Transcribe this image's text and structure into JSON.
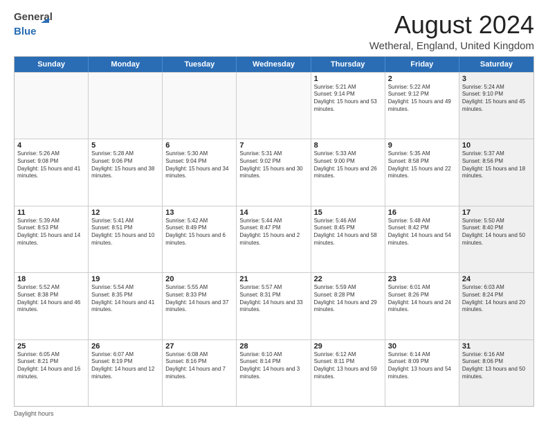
{
  "logo": {
    "general": "General",
    "blue": "Blue"
  },
  "title": "August 2024",
  "location": "Wetheral, England, United Kingdom",
  "days_header": [
    "Sunday",
    "Monday",
    "Tuesday",
    "Wednesday",
    "Thursday",
    "Friday",
    "Saturday"
  ],
  "footer_label": "Daylight hours",
  "rows": [
    [
      {
        "day": "",
        "empty": true
      },
      {
        "day": "",
        "empty": true
      },
      {
        "day": "",
        "empty": true
      },
      {
        "day": "",
        "empty": true
      },
      {
        "day": "1",
        "sunrise": "Sunrise: 5:21 AM",
        "sunset": "Sunset: 9:14 PM",
        "daylight": "Daylight: 15 hours and 53 minutes."
      },
      {
        "day": "2",
        "sunrise": "Sunrise: 5:22 AM",
        "sunset": "Sunset: 9:12 PM",
        "daylight": "Daylight: 15 hours and 49 minutes."
      },
      {
        "day": "3",
        "sunrise": "Sunrise: 5:24 AM",
        "sunset": "Sunset: 9:10 PM",
        "daylight": "Daylight: 15 hours and 45 minutes.",
        "shaded": true
      }
    ],
    [
      {
        "day": "4",
        "sunrise": "Sunrise: 5:26 AM",
        "sunset": "Sunset: 9:08 PM",
        "daylight": "Daylight: 15 hours and 41 minutes."
      },
      {
        "day": "5",
        "sunrise": "Sunrise: 5:28 AM",
        "sunset": "Sunset: 9:06 PM",
        "daylight": "Daylight: 15 hours and 38 minutes."
      },
      {
        "day": "6",
        "sunrise": "Sunrise: 5:30 AM",
        "sunset": "Sunset: 9:04 PM",
        "daylight": "Daylight: 15 hours and 34 minutes."
      },
      {
        "day": "7",
        "sunrise": "Sunrise: 5:31 AM",
        "sunset": "Sunset: 9:02 PM",
        "daylight": "Daylight: 15 hours and 30 minutes."
      },
      {
        "day": "8",
        "sunrise": "Sunrise: 5:33 AM",
        "sunset": "Sunset: 9:00 PM",
        "daylight": "Daylight: 15 hours and 26 minutes."
      },
      {
        "day": "9",
        "sunrise": "Sunrise: 5:35 AM",
        "sunset": "Sunset: 8:58 PM",
        "daylight": "Daylight: 15 hours and 22 minutes."
      },
      {
        "day": "10",
        "sunrise": "Sunrise: 5:37 AM",
        "sunset": "Sunset: 8:56 PM",
        "daylight": "Daylight: 15 hours and 18 minutes.",
        "shaded": true
      }
    ],
    [
      {
        "day": "11",
        "sunrise": "Sunrise: 5:39 AM",
        "sunset": "Sunset: 8:53 PM",
        "daylight": "Daylight: 15 hours and 14 minutes."
      },
      {
        "day": "12",
        "sunrise": "Sunrise: 5:41 AM",
        "sunset": "Sunset: 8:51 PM",
        "daylight": "Daylight: 15 hours and 10 minutes."
      },
      {
        "day": "13",
        "sunrise": "Sunrise: 5:42 AM",
        "sunset": "Sunset: 8:49 PM",
        "daylight": "Daylight: 15 hours and 6 minutes."
      },
      {
        "day": "14",
        "sunrise": "Sunrise: 5:44 AM",
        "sunset": "Sunset: 8:47 PM",
        "daylight": "Daylight: 15 hours and 2 minutes."
      },
      {
        "day": "15",
        "sunrise": "Sunrise: 5:46 AM",
        "sunset": "Sunset: 8:45 PM",
        "daylight": "Daylight: 14 hours and 58 minutes."
      },
      {
        "day": "16",
        "sunrise": "Sunrise: 5:48 AM",
        "sunset": "Sunset: 8:42 PM",
        "daylight": "Daylight: 14 hours and 54 minutes."
      },
      {
        "day": "17",
        "sunrise": "Sunrise: 5:50 AM",
        "sunset": "Sunset: 8:40 PM",
        "daylight": "Daylight: 14 hours and 50 minutes.",
        "shaded": true
      }
    ],
    [
      {
        "day": "18",
        "sunrise": "Sunrise: 5:52 AM",
        "sunset": "Sunset: 8:38 PM",
        "daylight": "Daylight: 14 hours and 46 minutes."
      },
      {
        "day": "19",
        "sunrise": "Sunrise: 5:54 AM",
        "sunset": "Sunset: 8:35 PM",
        "daylight": "Daylight: 14 hours and 41 minutes."
      },
      {
        "day": "20",
        "sunrise": "Sunrise: 5:55 AM",
        "sunset": "Sunset: 8:33 PM",
        "daylight": "Daylight: 14 hours and 37 minutes."
      },
      {
        "day": "21",
        "sunrise": "Sunrise: 5:57 AM",
        "sunset": "Sunset: 8:31 PM",
        "daylight": "Daylight: 14 hours and 33 minutes."
      },
      {
        "day": "22",
        "sunrise": "Sunrise: 5:59 AM",
        "sunset": "Sunset: 8:28 PM",
        "daylight": "Daylight: 14 hours and 29 minutes."
      },
      {
        "day": "23",
        "sunrise": "Sunrise: 6:01 AM",
        "sunset": "Sunset: 8:26 PM",
        "daylight": "Daylight: 14 hours and 24 minutes."
      },
      {
        "day": "24",
        "sunrise": "Sunrise: 6:03 AM",
        "sunset": "Sunset: 8:24 PM",
        "daylight": "Daylight: 14 hours and 20 minutes.",
        "shaded": true
      }
    ],
    [
      {
        "day": "25",
        "sunrise": "Sunrise: 6:05 AM",
        "sunset": "Sunset: 8:21 PM",
        "daylight": "Daylight: 14 hours and 16 minutes."
      },
      {
        "day": "26",
        "sunrise": "Sunrise: 6:07 AM",
        "sunset": "Sunset: 8:19 PM",
        "daylight": "Daylight: 14 hours and 12 minutes."
      },
      {
        "day": "27",
        "sunrise": "Sunrise: 6:08 AM",
        "sunset": "Sunset: 8:16 PM",
        "daylight": "Daylight: 14 hours and 7 minutes."
      },
      {
        "day": "28",
        "sunrise": "Sunrise: 6:10 AM",
        "sunset": "Sunset: 8:14 PM",
        "daylight": "Daylight: 14 hours and 3 minutes."
      },
      {
        "day": "29",
        "sunrise": "Sunrise: 6:12 AM",
        "sunset": "Sunset: 8:11 PM",
        "daylight": "Daylight: 13 hours and 59 minutes."
      },
      {
        "day": "30",
        "sunrise": "Sunrise: 6:14 AM",
        "sunset": "Sunset: 8:09 PM",
        "daylight": "Daylight: 13 hours and 54 minutes."
      },
      {
        "day": "31",
        "sunrise": "Sunrise: 6:16 AM",
        "sunset": "Sunset: 8:06 PM",
        "daylight": "Daylight: 13 hours and 50 minutes.",
        "shaded": true
      }
    ]
  ]
}
